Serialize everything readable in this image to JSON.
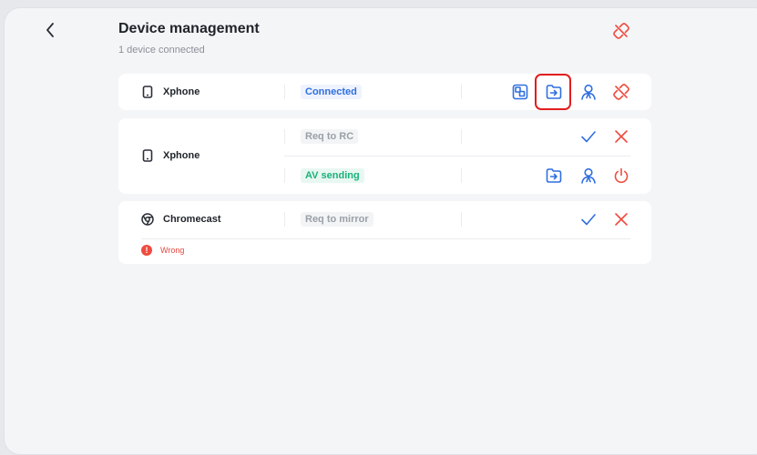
{
  "header": {
    "title": "Device management",
    "subtitle": "1 device connected",
    "back_icon": "chevron-left-icon",
    "disconnect_all_icon": "disconnect-icon"
  },
  "devices": [
    {
      "name": "Xphone",
      "icon": "phone-icon",
      "rows": [
        {
          "status": "Connected",
          "status_color": "#2f6fe0",
          "actions": [
            "screen-share-icon",
            "file-transfer-icon",
            "user-control-icon",
            "disconnect-icon"
          ]
        }
      ]
    },
    {
      "name": "Xphone",
      "icon": "phone-icon",
      "rows": [
        {
          "status": "Req to RC",
          "status_color": "#9aa0a8",
          "actions": [
            "accept-icon",
            "reject-icon"
          ]
        },
        {
          "status": "AV sending",
          "status_color": "#19b27a",
          "actions": [
            "file-transfer-icon",
            "user-control-icon",
            "power-icon"
          ]
        }
      ]
    },
    {
      "name": "Chromecast",
      "icon": "chrome-icon",
      "rows": [
        {
          "status": "Req to mirror",
          "status_color": "#9aa0a8",
          "actions": [
            "accept-icon",
            "reject-icon"
          ]
        }
      ],
      "error": {
        "text": "Wrong",
        "icon": "error-icon"
      }
    }
  ],
  "colors": {
    "accent_blue": "#2f6fe0",
    "danger_red": "#e5473d",
    "success_green": "#19b27a",
    "highlight_red": "#e31d1d"
  }
}
